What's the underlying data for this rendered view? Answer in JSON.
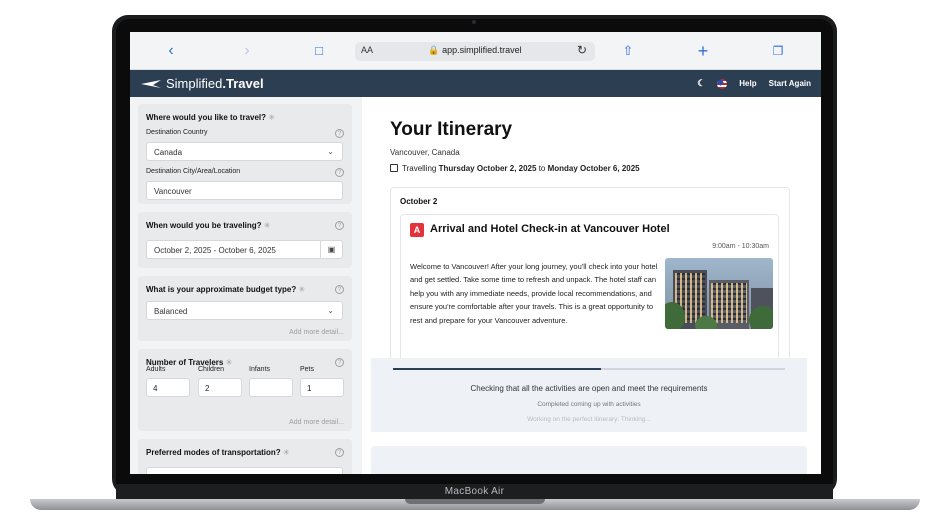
{
  "device": {
    "label": "MacBook Air"
  },
  "browser": {
    "text_size_label": "AA",
    "url": "app.simplified.travel",
    "icons": [
      "back-icon",
      "forward-icon",
      "book-icon",
      "lock-icon",
      "reload-icon",
      "share-icon",
      "new-tab-icon",
      "tabs-icon"
    ]
  },
  "header": {
    "brand_light": "Simplified",
    "brand_bold": ".Travel",
    "help": "Help",
    "start_again": "Start Again",
    "colors": {
      "bar": "#2c3e52"
    }
  },
  "form": {
    "destination": {
      "title": "Where would you like to travel?",
      "country_label": "Destination Country",
      "country_value": "Canada",
      "city_label": "Destination City/Area/Location",
      "city_value": "Vancouver"
    },
    "dates": {
      "title": "When would you be traveling?",
      "value": "October 2, 2025 - October 6, 2025"
    },
    "budget": {
      "title": "What is your approximate budget type?",
      "value": "Balanced",
      "add_more": "Add more detail..."
    },
    "travelers": {
      "title": "Number of Travelers",
      "labels": [
        "Adults",
        "Children",
        "Infants",
        "Pets"
      ],
      "values": [
        "4",
        "2",
        "",
        "1"
      ],
      "add_more": "Add more detail..."
    },
    "transport": {
      "title": "Preferred modes of transportation?"
    }
  },
  "itinerary": {
    "title": "Your Itinerary",
    "location": "Vancouver, Canada",
    "travelling_prefix": "Travelling",
    "start_date": "Thursday October 2, 2025",
    "to": "to",
    "end_date": "Monday October 6, 2025",
    "day": {
      "label": "October 2",
      "activity": {
        "badge": "A",
        "title": "Arrival and Hotel Check-in at Vancouver Hotel",
        "time": "9:00am - 10:30am",
        "description": "Welcome to Vancouver! After your long journey, you'll check into your hotel and get settled. Take some time to refresh and unpack. The hotel staff can help you with any immediate needs, provide local recommendations, and ensure you're comfortable after your travels. This is a great opportunity to rest and prepare for your Vancouver adventure."
      }
    }
  },
  "progress": {
    "fraction": 0.53,
    "main": "Checking that all the activities are open and meet the requirements",
    "sub1": "Completed coming up with activities",
    "sub2": "Working on the perfect itinerary: Thinking..."
  }
}
